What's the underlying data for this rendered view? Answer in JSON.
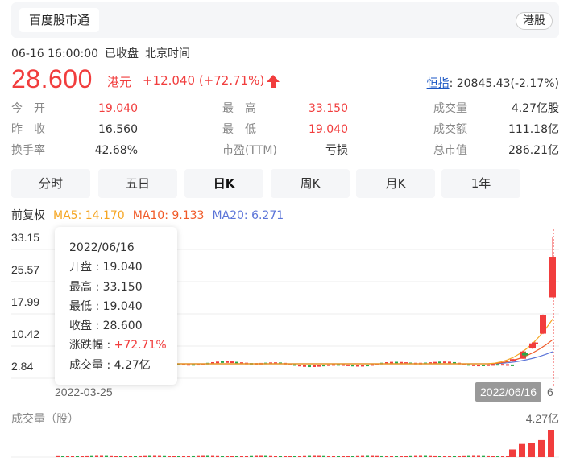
{
  "tab": {
    "label": "百度股市通",
    "market": "港股"
  },
  "status": {
    "datetime": "06-16 16:00:00",
    "state": "已收盘",
    "tz": "北京时间"
  },
  "quote": {
    "price": "28.600",
    "currency": "港元",
    "change": "+12.040 (+72.71%)"
  },
  "index": {
    "label": "恒指",
    "value": ": 20845.43(-2.17%)"
  },
  "stats": {
    "col1": [
      {
        "k": "今　开",
        "v": "19.040",
        "red": true
      },
      {
        "k": "昨　收",
        "v": "16.560",
        "red": false
      },
      {
        "k": "换手率",
        "v": "42.68%",
        "red": false
      }
    ],
    "col2": [
      {
        "k": "最　高",
        "v": "33.150",
        "red": true
      },
      {
        "k": "最　低",
        "v": "19.040",
        "red": true
      },
      {
        "k": "市盈(TTM)",
        "v": "亏损",
        "red": false
      }
    ],
    "col3": [
      {
        "k": "成交量",
        "v": "4.27亿股",
        "red": false
      },
      {
        "k": "成交额",
        "v": "111.18亿",
        "red": false
      },
      {
        "k": "总市值",
        "v": "286.21亿",
        "red": false
      }
    ]
  },
  "periods": [
    "分时",
    "五日",
    "日K",
    "周K",
    "月K",
    "1年"
  ],
  "active_period": "日K",
  "ma": {
    "adjust": "前复权",
    "ma5": "MA5: 14.170",
    "ma10": "MA10: 9.133",
    "ma20": "MA20: 6.271"
  },
  "colors": {
    "up": "#f13d3d",
    "down": "#2aa84a",
    "ma5": "#f5a623",
    "ma10": "#f05a28",
    "ma20": "#5b74d8"
  },
  "tooltip": {
    "date": "2022/06/16",
    "open": "开盘 : 19.040",
    "high": "最高 : 33.150",
    "low": "最低 : 19.040",
    "close": "收盘 : 28.600",
    "chg_label": "涨跌幅 : ",
    "chg_value": "+72.71%",
    "vol": "成交量 : 4.27亿"
  },
  "chart_data": {
    "type": "candlestick",
    "y_ticks": [
      "33.15",
      "25.57",
      "17.99",
      "10.42",
      "2.84"
    ],
    "ylim": [
      2.84,
      33.15
    ],
    "x_start_label": "2022-03-25",
    "x_selected_label": "2022/06/16",
    "x_end_label_tail": "6",
    "volume_title": "成交量（股）",
    "volume_max_label": "4.27亿",
    "recent_candles": [
      {
        "open": 4.0,
        "high": 4.6,
        "low": 3.9,
        "close": 4.5
      },
      {
        "open": 4.6,
        "high": 6.5,
        "low": 4.6,
        "close": 6.3
      },
      {
        "open": 6.0,
        "high": 6.3,
        "low": 5.1,
        "close": 5.4
      },
      {
        "open": 7.0,
        "high": 8.5,
        "low": 6.9,
        "close": 8.2
      },
      {
        "open": 8.0,
        "high": 8.6,
        "low": 7.9,
        "close": 8.4
      },
      {
        "open": 10.5,
        "high": 15.0,
        "low": 10.4,
        "close": 14.8
      },
      {
        "open": 19.04,
        "high": 33.15,
        "low": 19.04,
        "close": 28.6
      }
    ]
  }
}
